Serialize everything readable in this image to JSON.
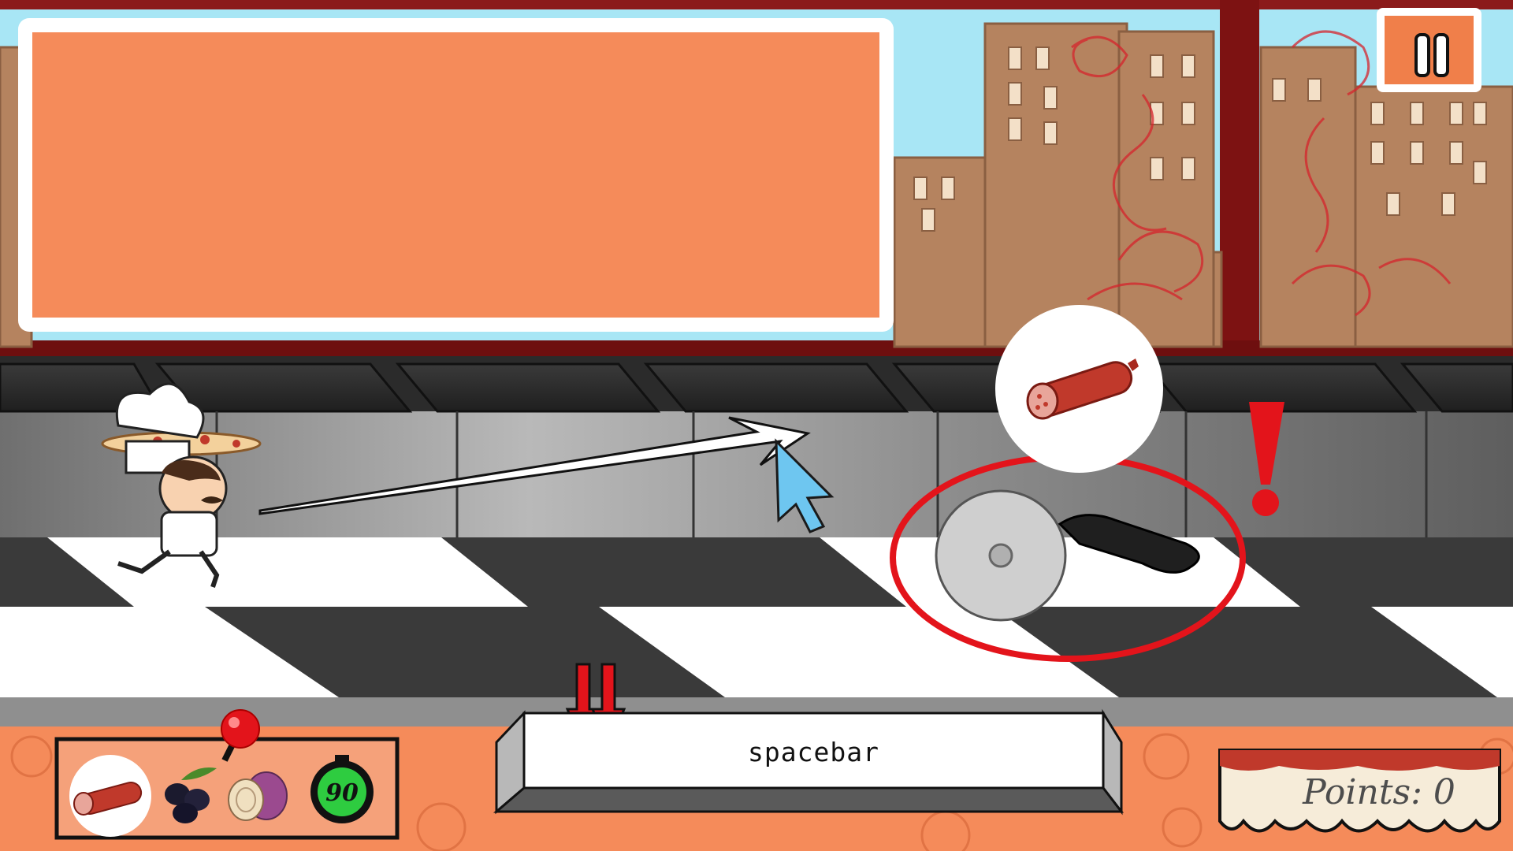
{
  "hud": {
    "key_prompt": "spacebar",
    "points_label": "Points: 0",
    "timer_value": "90"
  },
  "ingredients": [
    {
      "name": "salami",
      "selected": true
    },
    {
      "name": "olives",
      "selected": false
    },
    {
      "name": "onion",
      "selected": false
    }
  ],
  "icons": {
    "pause": "pause-icon",
    "warning": "exclamation-icon",
    "timer": "stopwatch-icon",
    "cursor": "cursor-icon",
    "hazard": "pizza-cutter-icon",
    "target_ingredient": "salami-icon"
  },
  "colors": {
    "panel_orange": "#f58b5a",
    "danger_red": "#e3141b",
    "frame_red": "#8b1a1a",
    "timer_green": "#2ecc40"
  }
}
